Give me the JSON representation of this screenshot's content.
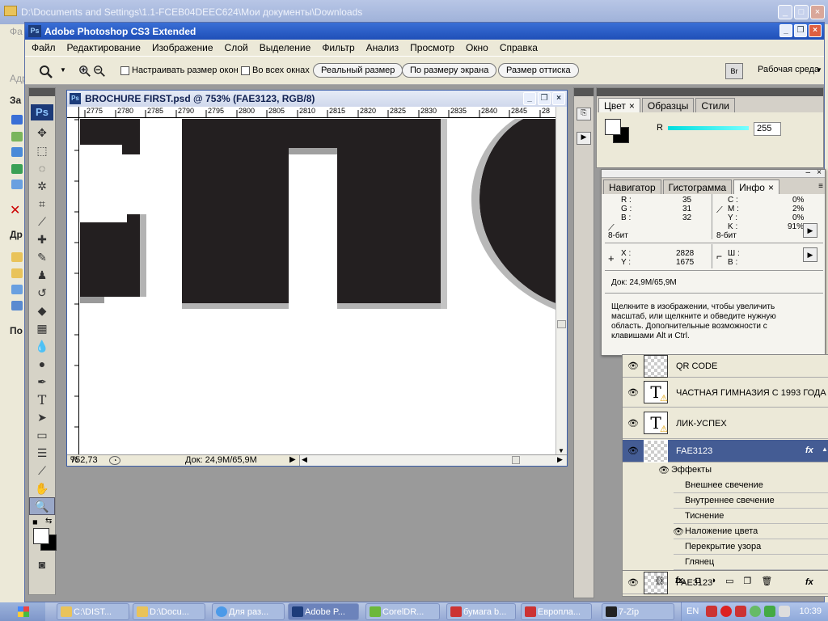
{
  "explorer": {
    "title": "D:\\Documents and Settings\\1.1-FCEB04DEEC624\\Мои документы\\Downloads",
    "left_labels": [
      "Фа",
      "Адр",
      "За",
      "Др",
      "По"
    ]
  },
  "photoshop": {
    "title": "Adobe Photoshop CS3 Extended",
    "logo": "Ps",
    "menu": [
      "Файл",
      "Редактирование",
      "Изображение",
      "Слой",
      "Выделение",
      "Фильтр",
      "Анализ",
      "Просмотр",
      "Окно",
      "Справка"
    ],
    "options": {
      "resize_windows": "Настраивать размер окон",
      "all_windows": "Во всех окнах",
      "actual_pixels": "Реальный размер",
      "fit_screen": "По размеру экрана",
      "print_size": "Размер оттиска",
      "workspace": "Рабочая среда"
    }
  },
  "document": {
    "title": "BROCHURE FIRST.psd @ 753% (FAE3123, RGB/8)",
    "ruler_ticks": [
      "2775",
      "2780",
      "2785",
      "2790",
      "2795",
      "2800",
      "2805",
      "2810",
      "2815",
      "2820",
      "2825",
      "2830",
      "2835",
      "2840",
      "2845",
      "28"
    ],
    "zoom": "752,73",
    "doc_size": "Док: 24,9М/65,9М"
  },
  "color_panel": {
    "tabs": [
      "Цвет",
      "Образцы",
      "Стили"
    ],
    "channel": "R",
    "value": "255"
  },
  "info_panel": {
    "tabs": [
      "Навигатор",
      "Гистограмма",
      "Инфо"
    ],
    "rgb": {
      "r_label": "R :",
      "g_label": "G :",
      "b_label": "B :",
      "r": "35",
      "g": "31",
      "b": "32",
      "bits": "8-бит"
    },
    "cmyk": {
      "c_label": "C :",
      "m_label": "M :",
      "y_label": "Y :",
      "k_label": "K :",
      "c": "0%",
      "m": "2%",
      "y": "0%",
      "k": "91%",
      "bits": "8-бит"
    },
    "xy": {
      "x_label": "X :",
      "y_label": "Y :",
      "x": "2828",
      "y": "1675"
    },
    "wh": {
      "w_label": "Ш :",
      "h_label": "В :"
    },
    "doc": "Док: 24,9М/65,9М",
    "hint": "Щелкните в изображении, чтобы увеличить масштаб, или щелкните и обведите нужную область. Дополнительные возможности с клавишами Alt и Ctrl."
  },
  "layers": [
    {
      "name": "QR CODE",
      "type": "smart"
    },
    {
      "name": "ЧАСТНАЯ ГИМНАЗИЯ С 1993 ГОДА",
      "type": "text"
    },
    {
      "name": "ЛИК-УСПЕХ",
      "type": "text"
    },
    {
      "name": "FAE3123",
      "type": "smart",
      "selected": true
    },
    {
      "name": "FAE3123",
      "type": "smart"
    }
  ],
  "effects": {
    "header": "Эффекты",
    "items": [
      "Внешнее свечение",
      "Внутреннее свечение",
      "Тиснение",
      "Наложение цвета",
      "Перекрытие узора",
      "Глянец"
    ]
  },
  "taskbar": {
    "tasks": [
      {
        "label": "C:\\DIST...",
        "color": "#e9c35a"
      },
      {
        "label": "D:\\Docu...",
        "color": "#e9c35a"
      },
      {
        "label": "Для раз...",
        "color": "#4c9ae8"
      },
      {
        "label": "Adobe P...",
        "color": "#1d3c7a"
      },
      {
        "label": "CorelDR...",
        "color": "#6cb83a"
      },
      {
        "label": "бумага b...",
        "color": "#c33"
      },
      {
        "label": "Европла...",
        "color": "#c33"
      },
      {
        "label": "7-Zip",
        "color": "#222"
      }
    ],
    "lang": "EN",
    "clock": "10:39"
  },
  "colors": {
    "titlebar": "#1f4fb8",
    "selected_layer": "#445c94",
    "artwork": "#231f20"
  }
}
